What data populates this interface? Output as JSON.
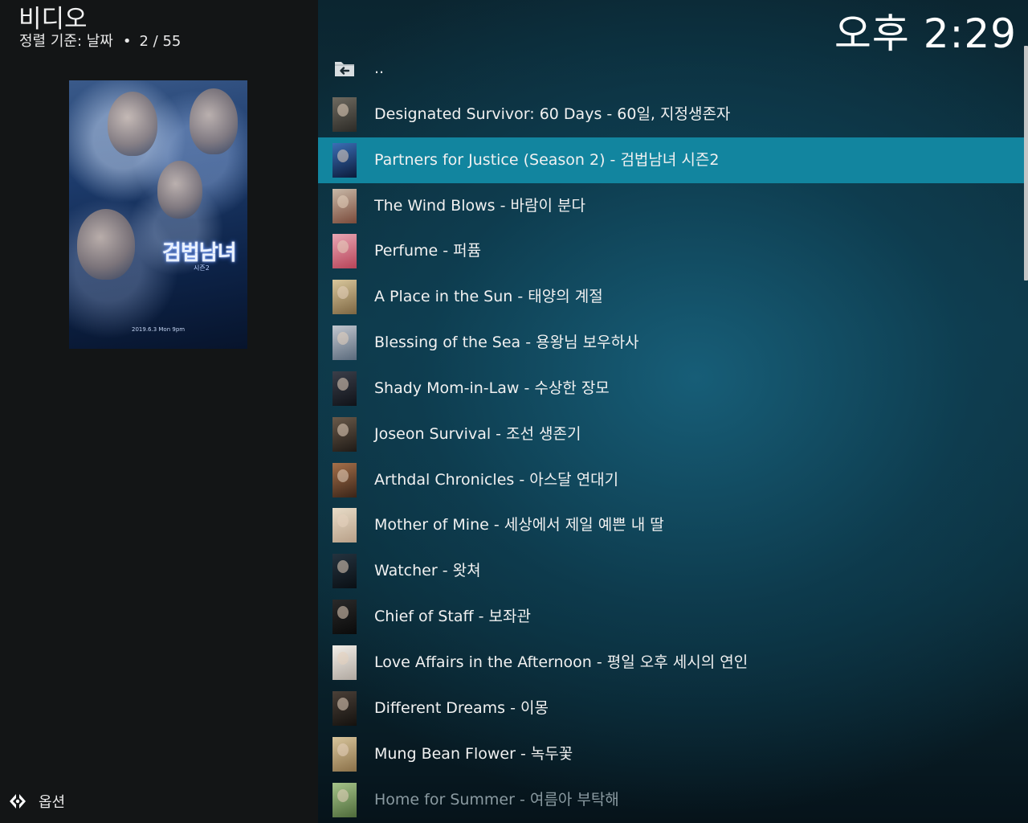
{
  "header": {
    "title": "비디오",
    "sort_label": "정렬 기준: 날짜",
    "separator": "•",
    "position": "2 / 55",
    "clock": "오후 2:29"
  },
  "poster": {
    "logo_text": "검법남녀",
    "logo_sub": "시즌2",
    "date_text": "2019.6.3 Mon 9pm"
  },
  "footer": {
    "options_label": "옵션"
  },
  "list": {
    "parent_label": "..",
    "selected_index": 1,
    "items": [
      {
        "label": "Designated Survivor: 60 Days - 60일, 지정생존자",
        "thumb_colors": [
          "#6e6a60",
          "#2c2a26"
        ]
      },
      {
        "label": "Partners for Justice (Season 2) - 검법남녀 시즌2",
        "thumb_colors": [
          "#3b6fb6",
          "#0b1a3a"
        ]
      },
      {
        "label": "The Wind Blows - 바람이 분다",
        "thumb_colors": [
          "#c8b9a8",
          "#7a4a3a"
        ]
      },
      {
        "label": "Perfume - 퍼퓸",
        "thumb_colors": [
          "#e8a7b4",
          "#b74358"
        ]
      },
      {
        "label": "A Place in the Sun - 태양의 계절",
        "thumb_colors": [
          "#d9c79c",
          "#7d6642"
        ]
      },
      {
        "label": "Blessing of the Sea - 용왕님 보우하사",
        "thumb_colors": [
          "#c2c7cf",
          "#5a6a7c"
        ]
      },
      {
        "label": "Shady Mom-in-Law - 수상한 장모",
        "thumb_colors": [
          "#3a3f4a",
          "#101218"
        ]
      },
      {
        "label": "Joseon Survival - 조선 생존기",
        "thumb_colors": [
          "#6a5a4a",
          "#1f1a16"
        ]
      },
      {
        "label": "Arthdal Chronicles - 아스달 연대기",
        "thumb_colors": [
          "#a5704a",
          "#3a2418"
        ]
      },
      {
        "label": "Mother of Mine - 세상에서 제일 예쁜 내 딸",
        "thumb_colors": [
          "#e8dcc8",
          "#b8a088"
        ]
      },
      {
        "label": "Watcher - 왓쳐",
        "thumb_colors": [
          "#24333f",
          "#0a0f14"
        ]
      },
      {
        "label": "Chief of Staff - 보좌관",
        "thumb_colors": [
          "#2a2a2a",
          "#0a0a0a"
        ]
      },
      {
        "label": "Love Affairs in the Afternoon - 평일 오후 세시의 연인",
        "thumb_colors": [
          "#f2eee8",
          "#b0a8a0"
        ]
      },
      {
        "label": "Different Dreams - 이몽",
        "thumb_colors": [
          "#4a4038",
          "#14110e"
        ]
      },
      {
        "label": "Mung Bean Flower - 녹두꽃",
        "thumb_colors": [
          "#d8c59c",
          "#8a7048"
        ]
      },
      {
        "label": "Home for Summer - 여름아 부탁해",
        "thumb_colors": [
          "#a6c48a",
          "#4d6a3a"
        ]
      }
    ]
  },
  "colors": {
    "selection": "#12859f",
    "left_background": "#131516",
    "right_background": "#0e3645"
  },
  "icons": {
    "parent_folder": "folder-back-icon",
    "options": "options-arrows-icon"
  }
}
